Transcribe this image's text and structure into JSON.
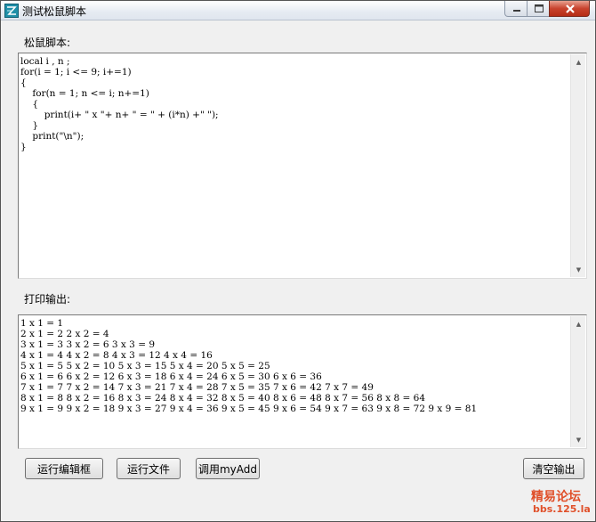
{
  "window": {
    "title": "测试松鼠脚本",
    "icon": "app-logo-icon",
    "controls": {
      "minimize": "minimize-icon",
      "maximize": "maximize-icon",
      "close": "close-icon"
    }
  },
  "script_section": {
    "label": "松鼠脚本:",
    "lines": [
      "local i , n ;",
      "for(i = 1; i <= 9; i+=1)",
      "{",
      "    for(n = 1; n <= i; n+=1)",
      "    {",
      "        print(i+ \" x \"+ n+ \" = \" + (i*n) +\" \");",
      "    }",
      "    print(\"\\n\");",
      "}"
    ]
  },
  "output_section": {
    "label": "打印输出:",
    "lines": [
      "1 x 1 = 1",
      "2 x 1 = 2 2 x 2 = 4",
      "3 x 1 = 3 3 x 2 = 6 3 x 3 = 9",
      "4 x 1 = 4 4 x 2 = 8 4 x 3 = 12 4 x 4 = 16",
      "5 x 1 = 5 5 x 2 = 10 5 x 3 = 15 5 x 4 = 20 5 x 5 = 25",
      "6 x 1 = 6 6 x 2 = 12 6 x 3 = 18 6 x 4 = 24 6 x 5 = 30 6 x 6 = 36",
      "7 x 1 = 7 7 x 2 = 14 7 x 3 = 21 7 x 4 = 28 7 x 5 = 35 7 x 6 = 42 7 x 7 = 49",
      "8 x 1 = 8 8 x 2 = 16 8 x 3 = 24 8 x 4 = 32 8 x 5 = 40 8 x 6 = 48 8 x 7 = 56 8 x 8 = 64",
      "9 x 1 = 9 9 x 2 = 18 9 x 3 = 27 9 x 4 = 36 9 x 5 = 45 9 x 6 = 54 9 x 7 = 63 9 x 8 = 72 9 x 9 = 81"
    ]
  },
  "buttons": {
    "run_editor": "运行编辑框",
    "run_file": "运行文件",
    "call_myadd": "调用myAdd",
    "clear_output": "清空输出"
  },
  "watermark": {
    "main": "精易论坛",
    "sub": "bbs.125.la"
  }
}
